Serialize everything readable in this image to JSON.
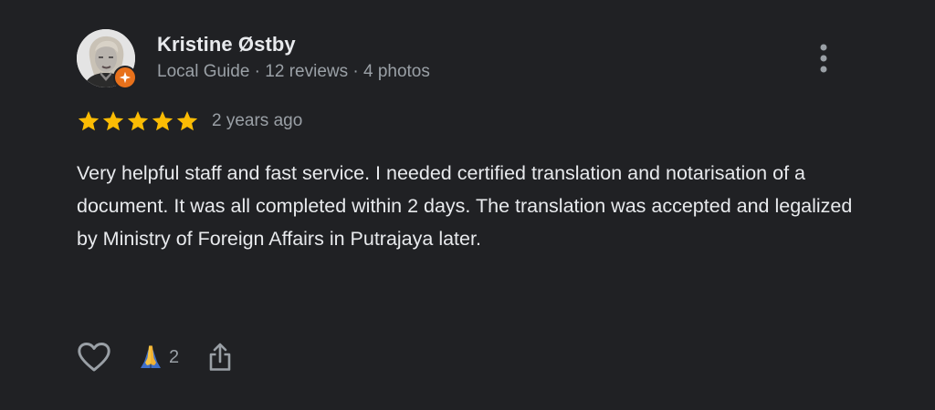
{
  "reviewer": {
    "name": "Kristine Østby",
    "meta": "Local Guide · 12 reviews · 4 photos",
    "badge_icon": "local-guide-star-icon",
    "badge_color": "#e8711b"
  },
  "review": {
    "rating": 5,
    "rating_max": 5,
    "star_color": "#fbbc04",
    "age": "2 years ago",
    "text": "Very helpful staff and fast service. I needed certified translation and notarisation of a document. It was all completed within 2 days. The translation was accepted and legalized by Ministry of Foreign Affairs in Putrajaya later."
  },
  "actions": {
    "like_icon": "heart-outline-icon",
    "reaction_icon": "folded-hands-icon",
    "reaction_count": "2",
    "share_icon": "share-icon",
    "more_icon": "more-vertical-icon"
  },
  "theme": {
    "background": "#202124",
    "primary_text": "#e8eaed",
    "secondary_text": "#9aa0a6"
  }
}
